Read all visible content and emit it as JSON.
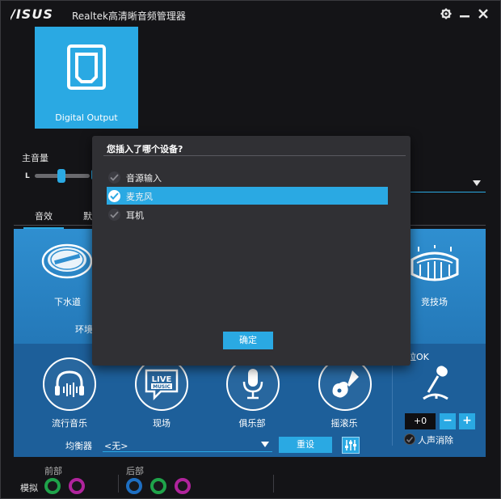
{
  "app": {
    "logo": "/ISUS",
    "title": "Realtek高清晰音频管理器",
    "settings_icon": "gear-icon",
    "minimize_icon": "minimize-icon",
    "close_icon": "close-icon"
  },
  "device": {
    "label": "Digital Output",
    "icon": "digital-output-icon"
  },
  "volume": {
    "label": "主音量",
    "left_label": "L"
  },
  "tabs": [
    {
      "label": "音效",
      "active": true
    },
    {
      "label": "默"
    }
  ],
  "environment": {
    "label": "环境",
    "items": [
      {
        "label": "下水道",
        "icon": "sewer-pipe-icon"
      },
      {
        "label": "竞技场",
        "icon": "stadium-icon"
      }
    ]
  },
  "presets": [
    {
      "label": "流行音乐",
      "icon": "headphones-icon"
    },
    {
      "label": "现场",
      "icon": "live-music-icon"
    },
    {
      "label": "俱乐部",
      "icon": "microphone-icon"
    },
    {
      "label": "摇滚乐",
      "icon": "electric-guitar-icon"
    }
  ],
  "equalizer": {
    "label": "均衡器",
    "selected": "<无>",
    "reset_label": "重设",
    "settings_icon": "equalizer-sliders-icon"
  },
  "karaoke": {
    "label": "拉OK",
    "value": "+0",
    "minus_label": "−",
    "plus_label": "+",
    "vocal_cancel_label": "人声消除",
    "icon": "karaoke-mic-icon"
  },
  "jacks": {
    "front_label": "前部",
    "rear_label": "后部",
    "analog_label": "模拟",
    "front_colors": [
      "#1fa34a",
      "#b0249c"
    ],
    "rear_colors": [
      "#1e6fc2",
      "#1fa34a",
      "#b0249c"
    ]
  },
  "dialog": {
    "title": "您插入了哪个设备?",
    "options": [
      {
        "label": "音源输入",
        "selected": false
      },
      {
        "label": "麦克风",
        "selected": true
      },
      {
        "label": "耳机",
        "selected": false
      }
    ],
    "ok_label": "确定"
  },
  "colors": {
    "accent": "#2aa9e3",
    "panel": "#2478b8"
  }
}
